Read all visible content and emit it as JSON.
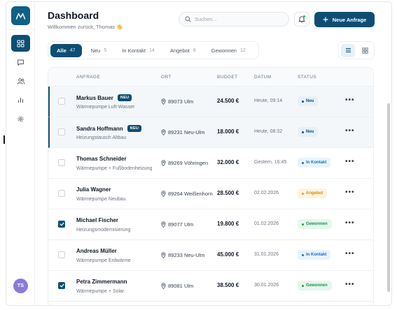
{
  "header": {
    "title": "Dashboard",
    "subtitle": "Willkommen zurück, Thomas 👋",
    "search_placeholder": "Suchen...",
    "new_button_label": "Neue Anfrage"
  },
  "sidebar": {
    "items": [
      {
        "icon": "grid-icon",
        "active": true
      },
      {
        "icon": "chat-icon",
        "active": false
      },
      {
        "icon": "users-icon",
        "active": false
      },
      {
        "icon": "bar-chart-icon",
        "active": false
      },
      {
        "icon": "gear-icon",
        "active": false
      }
    ],
    "avatar_initials": "TS"
  },
  "tabs": [
    {
      "label": "Alle",
      "count": "47",
      "active": true
    },
    {
      "label": "Neu",
      "count": "5",
      "active": false
    },
    {
      "label": "In Kontakt",
      "count": "14",
      "active": false
    },
    {
      "label": "Angebot",
      "count": "8",
      "active": false
    },
    {
      "label": "Gewonnen",
      "count": "12",
      "active": false
    }
  ],
  "table": {
    "columns": [
      "ANFRAGE",
      "ORT",
      "BUDGET",
      "DATUM",
      "STATUS"
    ],
    "rows": [
      {
        "name": "Markus Bauer",
        "badge": "NEU",
        "product": "Wärmepumpe Luft-Wasser",
        "ort": "89073 Ulm",
        "budget": "24.500 €",
        "datum": "Heute, 09:14",
        "status": "Neu",
        "status_kind": "neu",
        "checked": false,
        "highlight": true
      },
      {
        "name": "Sandra Hoffmann",
        "badge": "NEU",
        "product": "Heizungstausch Altbau",
        "ort": "89231 Neu-Ulm",
        "budget": "18.000 €",
        "datum": "Heute, 08:32",
        "status": "Neu",
        "status_kind": "neu",
        "checked": false,
        "highlight": true
      },
      {
        "name": "Thomas Schneider",
        "badge": "",
        "product": "Wärmepumpe + Fußbodenheizung",
        "ort": "89269 Vöhringen",
        "budget": "32.000 €",
        "datum": "Gestern, 16:45",
        "status": "In Kontakt",
        "status_kind": "kontakt",
        "checked": false,
        "highlight": false
      },
      {
        "name": "Julia Wagner",
        "badge": "",
        "product": "Wärmepumpe Neubau",
        "ort": "89264 Weißenhorn",
        "budget": "28.500 €",
        "datum": "02.02.2026",
        "status": "Angebot",
        "status_kind": "angebot",
        "checked": false,
        "highlight": false
      },
      {
        "name": "Michael Fischer",
        "badge": "",
        "product": "Heizungsmodernisierung",
        "ort": "89077 Ulm",
        "budget": "19.800 €",
        "datum": "01.02.2026",
        "status": "Gewonnen",
        "status_kind": "gewonnen",
        "checked": true,
        "highlight": false
      },
      {
        "name": "Andreas Müller",
        "badge": "",
        "product": "Wärmepumpe Erdwärme",
        "ort": "89233 Neu-Ulm",
        "budget": "45.000 €",
        "datum": "31.01.2026",
        "status": "In Kontakt",
        "status_kind": "kontakt",
        "checked": false,
        "highlight": false
      },
      {
        "name": "Petra Zimmermann",
        "badge": "",
        "product": "Wärmepumpe + Solar",
        "ort": "89081 Ulm",
        "budget": "38.500 €",
        "datum": "30.01.2026",
        "status": "Gewonnen",
        "status_kind": "gewonnen",
        "checked": true,
        "highlight": false
      }
    ]
  },
  "colors": {
    "primary": "#0f4e73",
    "neu": "#0f4e73",
    "in_kontakt": "#1d70b8",
    "angebot": "#f59e0b",
    "gewonnen": "#16a34a"
  }
}
